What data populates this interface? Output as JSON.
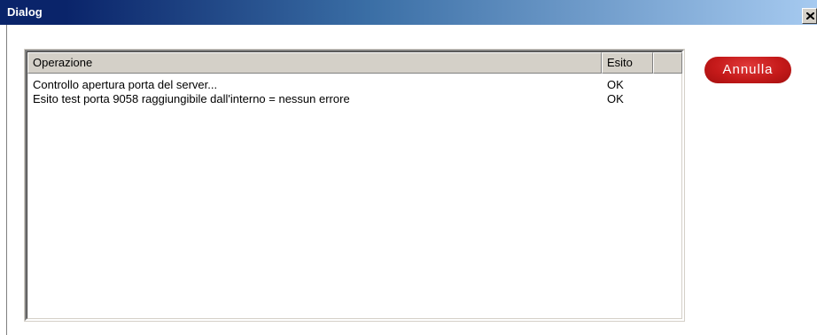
{
  "window": {
    "title": "Dialog"
  },
  "list": {
    "columns": [
      "Operazione",
      "Esito"
    ],
    "rows": [
      {
        "operazione": "Controllo apertura porta del server...",
        "esito": "OK"
      },
      {
        "operazione": "Esito test porta 9058 raggiungibile dall'interno = nessun errore",
        "esito": "OK"
      }
    ]
  },
  "buttons": {
    "cancel_label": "Annulla"
  },
  "colors": {
    "titlebar_dark": "#0a246a",
    "titlebar_light": "#a6caf0",
    "cancel_button": "#c51a1a"
  },
  "icons": {
    "close": "close-icon"
  }
}
